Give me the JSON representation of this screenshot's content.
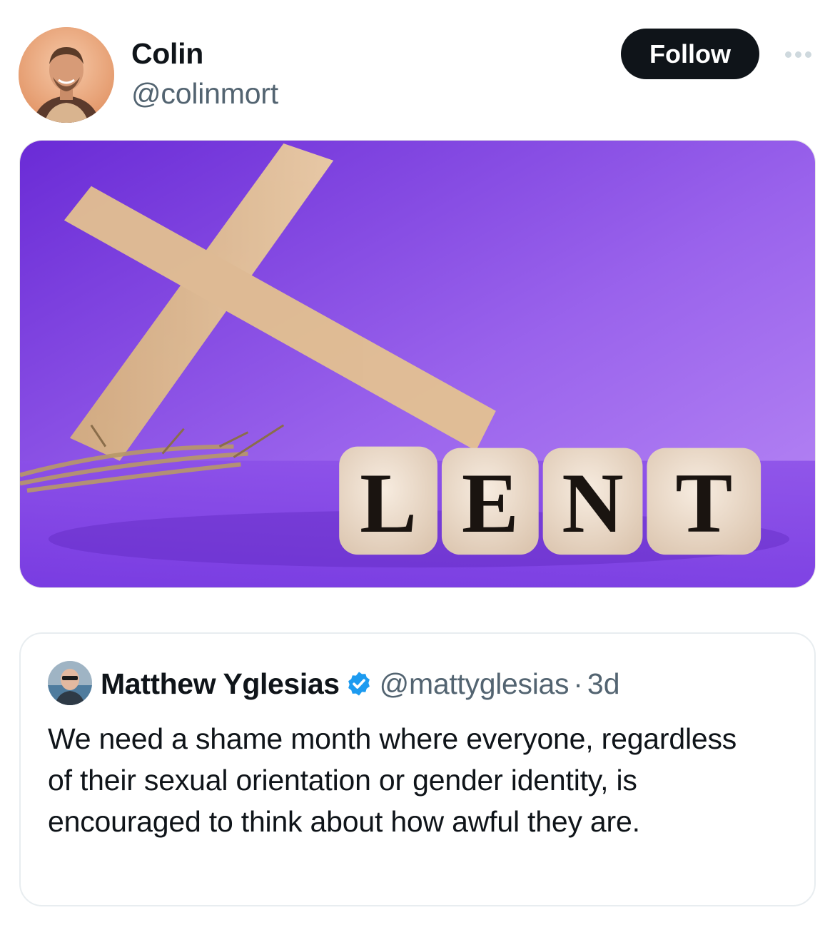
{
  "author": {
    "display_name": "Colin",
    "handle": "@colinmort",
    "avatar_icon": "user-avatar-photo"
  },
  "actions": {
    "follow_label": "Follow",
    "more_icon": "more-horizontal-icon"
  },
  "media": {
    "description_icon": "lent-cross-image",
    "dice_letters": [
      "L",
      "E",
      "N",
      "T"
    ],
    "background_color": "#8a52e6"
  },
  "quoted_tweet": {
    "display_name": "Matthew Yglesias",
    "verified_icon": "verified-badge-icon",
    "verified_color": "#1d9bf0",
    "handle": "@mattyglesias",
    "separator": "·",
    "time": "3d",
    "text": "We need a shame month where everyone, regardless of their sexual orientation or gender identity, is encouraged to think about how awful they are."
  }
}
